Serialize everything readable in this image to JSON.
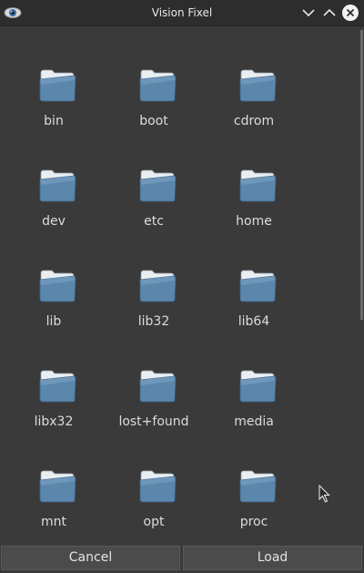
{
  "window": {
    "title": "Vision Fixel",
    "app_icon": "eye-icon",
    "controls": {
      "minimize_icon": "chevron-down-icon",
      "maximize_icon": "chevron-up-icon",
      "close_icon": "close-icon"
    }
  },
  "folders": [
    {
      "label": "bin"
    },
    {
      "label": "boot"
    },
    {
      "label": "cdrom"
    },
    {
      "label": "dev"
    },
    {
      "label": "etc"
    },
    {
      "label": "home"
    },
    {
      "label": "lib"
    },
    {
      "label": "lib32"
    },
    {
      "label": "lib64"
    },
    {
      "label": "libx32"
    },
    {
      "label": "lost+found"
    },
    {
      "label": "media"
    },
    {
      "label": "mnt"
    },
    {
      "label": "opt"
    },
    {
      "label": "proc"
    }
  ],
  "folder_icon": "folder-icon",
  "footer": {
    "cancel_label": "Cancel",
    "load_label": "Load"
  },
  "colors": {
    "background": "#3a3a3a",
    "titlebar": "#2d2d2d",
    "folder_body": "#5a8ab0",
    "text": "#dcdcdc"
  }
}
